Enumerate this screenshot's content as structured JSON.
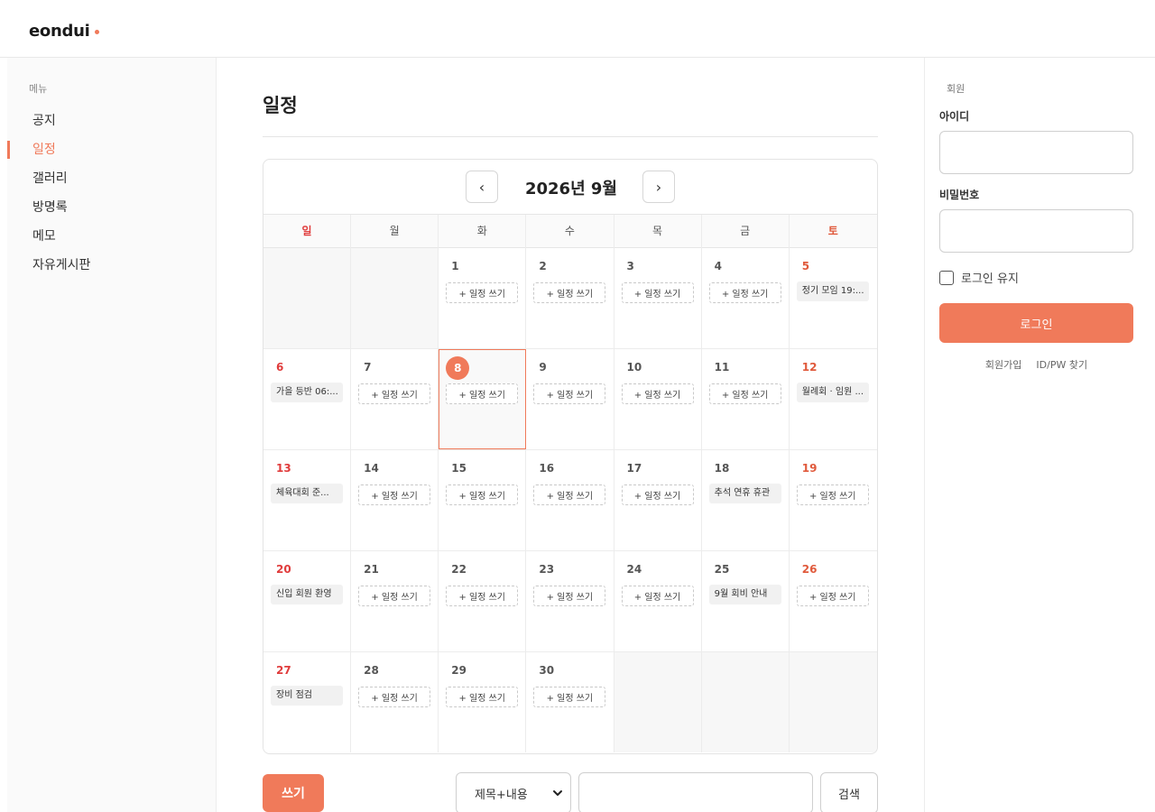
{
  "brand": {
    "name": "eondui",
    "accent": "#f07a5a"
  },
  "sidebar": {
    "heading": "메뉴",
    "items": [
      {
        "label": "공지",
        "active": false
      },
      {
        "label": "일정",
        "active": true
      },
      {
        "label": "갤러리",
        "active": false
      },
      {
        "label": "방명록",
        "active": false
      },
      {
        "label": "메모",
        "active": false
      },
      {
        "label": "자유게시판",
        "active": false
      }
    ]
  },
  "main": {
    "title": "일정",
    "calendar": {
      "month_label": "2026년 9월",
      "prev_icon": "‹",
      "next_icon": "›",
      "weekdays": [
        "일",
        "월",
        "화",
        "수",
        "목",
        "금",
        "토"
      ],
      "add_label": "+ 일정 쓰기",
      "today": 8,
      "weeks": [
        [
          {
            "day": null
          },
          {
            "day": null
          },
          {
            "day": 1
          },
          {
            "day": 2
          },
          {
            "day": 3
          },
          {
            "day": 4
          },
          {
            "day": 5,
            "event": "정기 모임 19:..."
          }
        ],
        [
          {
            "day": 6,
            "event": "가을 등반 06:..."
          },
          {
            "day": 7
          },
          {
            "day": 8
          },
          {
            "day": 9
          },
          {
            "day": 10
          },
          {
            "day": 11
          },
          {
            "day": 12,
            "event": "월례회 · 임원 ..."
          }
        ],
        [
          {
            "day": 13,
            "event": "체육대회 준..."
          },
          {
            "day": 14
          },
          {
            "day": 15
          },
          {
            "day": 16
          },
          {
            "day": 17
          },
          {
            "day": 18,
            "event": "추석 연휴 휴관"
          },
          {
            "day": 19
          }
        ],
        [
          {
            "day": 20,
            "event": "신입 회원 환영"
          },
          {
            "day": 21
          },
          {
            "day": 22
          },
          {
            "day": 23
          },
          {
            "day": 24
          },
          {
            "day": 25,
            "event": "9월 회비 안내"
          },
          {
            "day": 26
          }
        ],
        [
          {
            "day": 27,
            "event": "장비 점검"
          },
          {
            "day": 28
          },
          {
            "day": 29
          },
          {
            "day": 30
          },
          {
            "day": null
          },
          {
            "day": null
          },
          {
            "day": null
          }
        ]
      ]
    },
    "write_label": "쓰기",
    "search": {
      "scope_value": "제목+내용",
      "query": "",
      "button_label": "검색"
    }
  },
  "member": {
    "heading": "회원",
    "id_label": "아이디",
    "pw_label": "비밀번호",
    "remember_label": "로그인 유지",
    "login_label": "로그인",
    "signup_label": "회원가입",
    "find_label": "ID/PW 찾기"
  }
}
